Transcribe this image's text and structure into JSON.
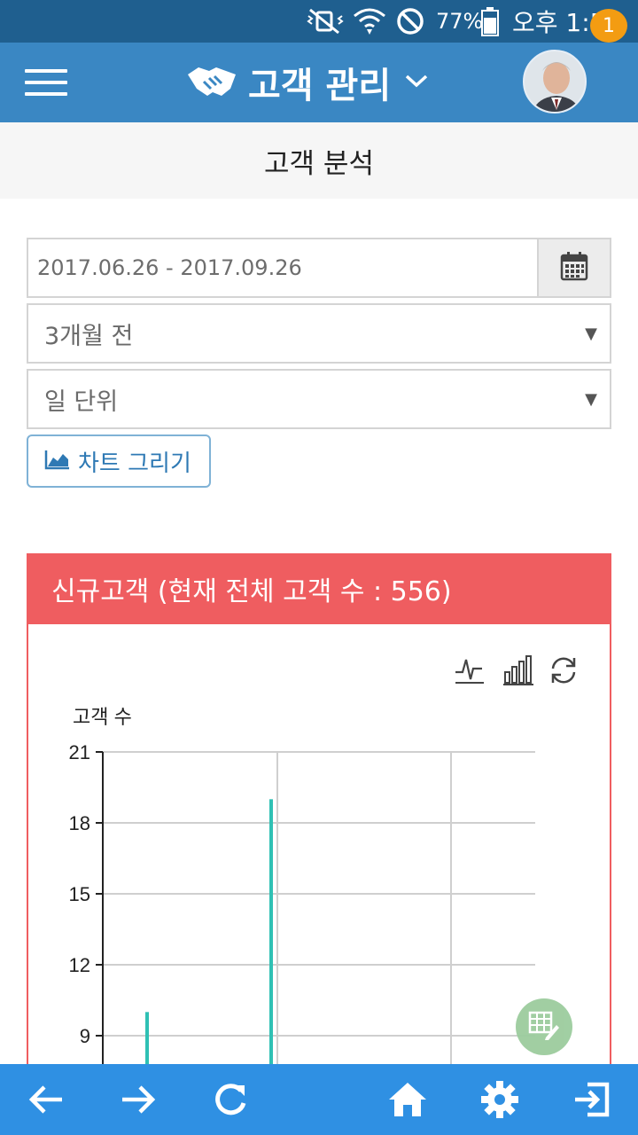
{
  "status_bar": {
    "battery_percent": "77%",
    "time": "오후 1:54",
    "icons": [
      "vibrate-mute-icon",
      "wifi-icon",
      "do-not-disturb-icon",
      "battery-icon"
    ]
  },
  "header": {
    "app_title": "고객 관리",
    "notification_count": "1",
    "icons": [
      "menu-icon",
      "handshake-icon",
      "chevron-down-icon",
      "avatar"
    ]
  },
  "page": {
    "title": "고객 분석"
  },
  "filters": {
    "date_range": "2017.06.26 - 2017.09.26",
    "period_select": "3개월 전",
    "unit_select": "일 단위",
    "draw_chart_label": "차트 그리기"
  },
  "panel": {
    "title": "신규고객 (현재 전체 고객 수 : 556)",
    "tools": [
      "line-chart-icon",
      "bar-chart-icon",
      "refresh-icon"
    ],
    "accent_color": "#ef5d60"
  },
  "chart_data": {
    "type": "bar",
    "title": "",
    "ylabel": "고객 수",
    "xlabel": "",
    "ylim": [
      9,
      21
    ],
    "yticks": [
      21,
      18,
      15,
      12,
      9
    ],
    "grid": true,
    "series": [
      {
        "values": [
          10,
          19
        ],
        "color": "#2fc0b4"
      }
    ]
  },
  "bottom_nav": {
    "icons": [
      "back-arrow-icon",
      "forward-arrow-icon",
      "reload-icon",
      "home-icon",
      "settings-icon",
      "logout-icon"
    ],
    "color": "#2f90e3"
  }
}
